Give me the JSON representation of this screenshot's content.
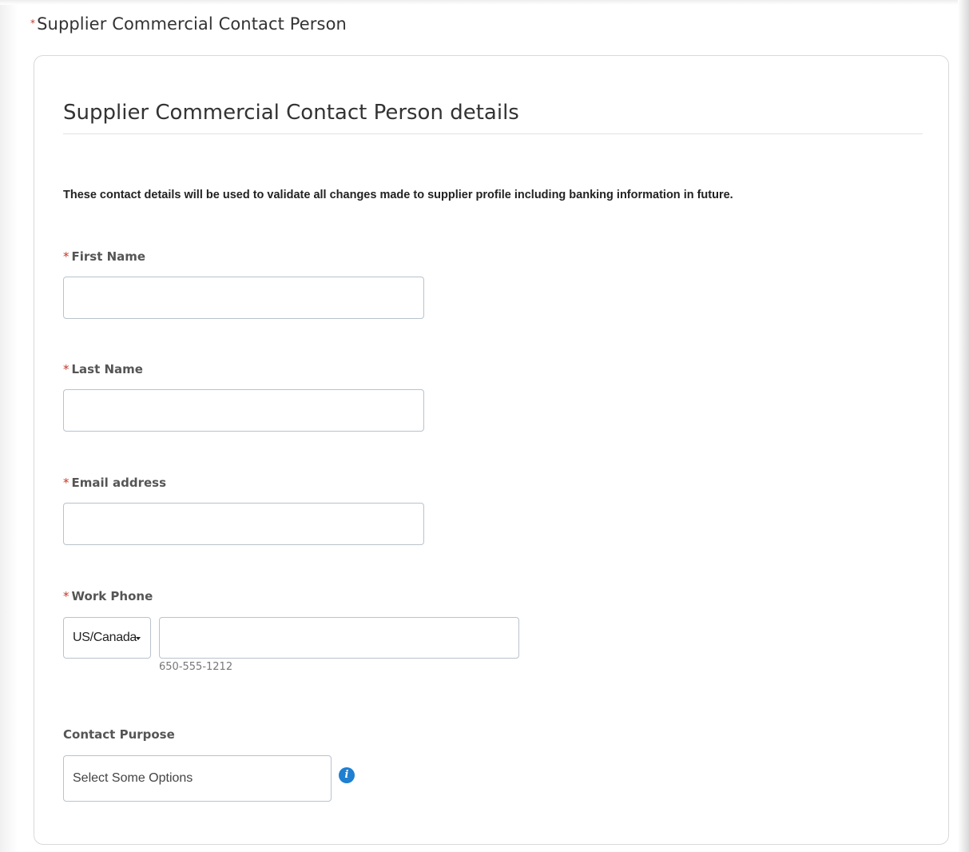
{
  "section": {
    "required_marker": "*",
    "title": "Supplier Commercial Contact Person"
  },
  "card": {
    "heading": "Supplier Commercial Contact Person details",
    "notice": "These contact details will be used to validate all changes made to supplier profile including banking information in future."
  },
  "fields": {
    "first_name": {
      "required_marker": "*",
      "label": "First Name",
      "value": ""
    },
    "last_name": {
      "required_marker": "*",
      "label": "Last Name",
      "value": ""
    },
    "email": {
      "required_marker": "*",
      "label": "Email address",
      "value": ""
    },
    "work_phone": {
      "required_marker": "*",
      "label": "Work Phone",
      "country": "US/Canada",
      "value": "",
      "hint": "650-555-1212"
    },
    "contact_purpose": {
      "label": "Contact Purpose",
      "placeholder": "Select Some Options",
      "info_icon": "info-icon",
      "info_glyph": "i"
    }
  },
  "colors": {
    "required": "#c0392b",
    "info_icon": "#1f7fd1",
    "input_border": "#b9c3cc"
  }
}
